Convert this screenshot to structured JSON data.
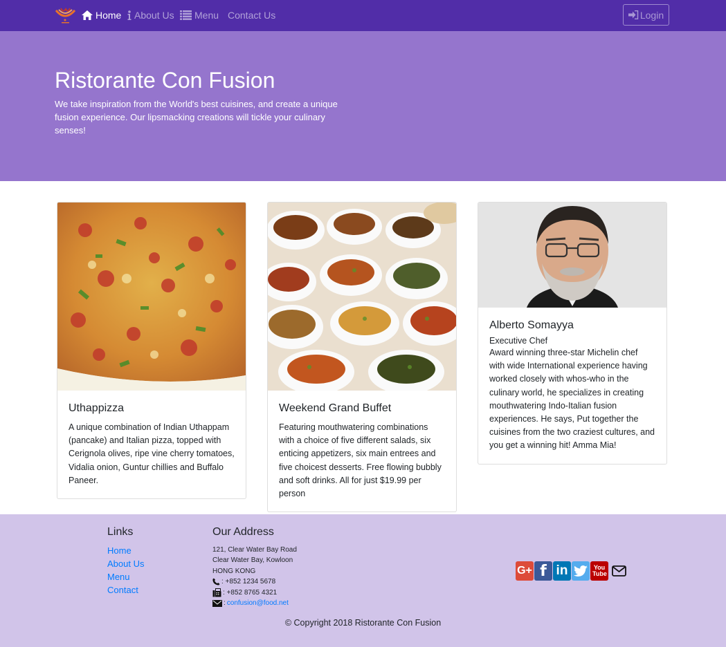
{
  "colors": {
    "nav_bg": "#512da8",
    "jumbo_bg": "#9575cd",
    "footer_bg": "#d1c4e9",
    "link": "#007bff",
    "google": "#dd4b39",
    "facebook": "#3b5998",
    "linkedin": "#0077b5",
    "twitter": "#55acee",
    "youtube": "#bb0000"
  },
  "nav": {
    "items": [
      {
        "label": "Home",
        "icon": "home-icon",
        "active": true
      },
      {
        "label": "About Us",
        "icon": "info-icon",
        "active": false
      },
      {
        "label": "Menu",
        "icon": "list-icon",
        "active": false
      },
      {
        "label": "Contact Us",
        "icon": "",
        "active": false
      }
    ],
    "login_label": "Login"
  },
  "jumbotron": {
    "title": "Ristorante Con Fusion",
    "text": "We take inspiration from the World's best cuisines, and create a unique fusion experience. Our lipsmacking creations will tickle your culinary senses!"
  },
  "cards": [
    {
      "title": "Uthappizza",
      "subtitle": "",
      "text": "A unique combination of Indian Uthappam (pancake) and Italian pizza, topped with Cerignola olives, ripe vine cherry tomatoes, Vidalia onion, Guntur chillies and Buffalo Paneer."
    },
    {
      "title": "Weekend Grand Buffet",
      "subtitle": "",
      "text": "Featuring mouthwatering combinations with a choice of five different salads, six enticing appetizers, six main entrees and five choicest desserts. Free flowing bubbly and soft drinks. All for just $19.99 per person"
    },
    {
      "title": "Alberto Somayya",
      "subtitle": "Executive Chef",
      "text": "Award winning three-star Michelin chef with wide International experience having worked closely with whos-who in the culinary world, he specializes in creating mouthwatering Indo-Italian fusion experiences. He says, Put together the cuisines from the two craziest cultures, and you get a winning hit! Amma Mia!"
    }
  ],
  "footer": {
    "links_title": "Links",
    "links": [
      "Home",
      "About Us",
      "Menu",
      "Contact"
    ],
    "address_title": "Our Address",
    "address_lines": [
      "121, Clear Water Bay Road",
      "Clear Water Bay, Kowloon",
      "HONG KONG"
    ],
    "phone": ": +852 1234 5678",
    "fax": ": +852 8765 4321",
    "email_prefix": ": ",
    "email": "confusion@food.net",
    "social": [
      {
        "name": "google-plus-icon",
        "glyph": "G+"
      },
      {
        "name": "facebook-icon",
        "glyph": "f"
      },
      {
        "name": "linkedin-icon",
        "glyph": "in"
      },
      {
        "name": "twitter-icon",
        "glyph": ""
      },
      {
        "name": "youtube-icon",
        "glyph": "You Tube"
      },
      {
        "name": "envelope-icon",
        "glyph": ""
      }
    ],
    "copyright": "© Copyright 2018 Ristorante Con Fusion"
  }
}
